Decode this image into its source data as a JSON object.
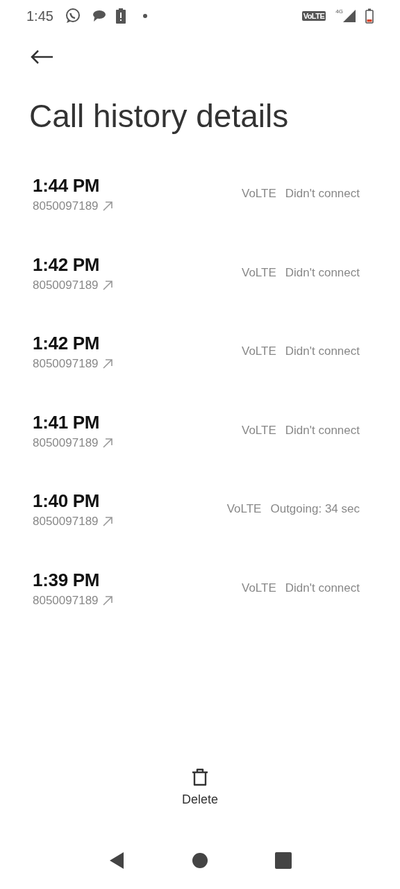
{
  "status_bar": {
    "time": "1:45",
    "volte_badge": "VoLTE",
    "network": "4G"
  },
  "title": "Call history details",
  "calls": [
    {
      "time": "1:44 PM",
      "number": "8050097189",
      "network": "VoLTE",
      "status": "Didn't connect"
    },
    {
      "time": "1:42 PM",
      "number": "8050097189",
      "network": "VoLTE",
      "status": "Didn't connect"
    },
    {
      "time": "1:42 PM",
      "number": "8050097189",
      "network": "VoLTE",
      "status": "Didn't connect"
    },
    {
      "time": "1:41 PM",
      "number": "8050097189",
      "network": "VoLTE",
      "status": "Didn't connect"
    },
    {
      "time": "1:40 PM",
      "number": "8050097189",
      "network": "VoLTE",
      "status": "Outgoing: 34 sec"
    },
    {
      "time": "1:39 PM",
      "number": "8050097189",
      "network": "VoLTE",
      "status": "Didn't connect"
    }
  ],
  "action": {
    "label": "Delete"
  }
}
